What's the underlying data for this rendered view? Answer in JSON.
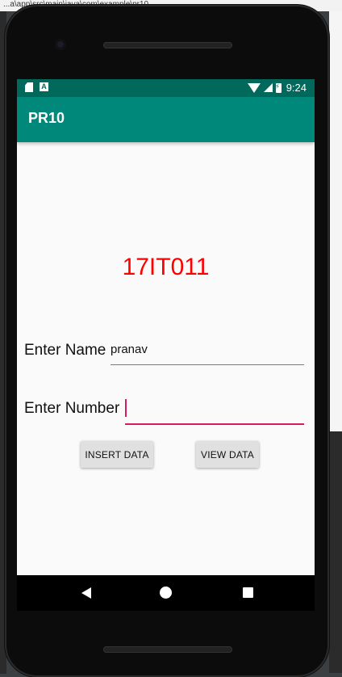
{
  "ide": {
    "top_path": "...a\\app\\src\\main\\java\\com\\example\\pr10..."
  },
  "status_bar": {
    "time": "9:24",
    "sd_icon": "sd-card-icon",
    "a_icon": "a-notification-icon"
  },
  "app_bar": {
    "title": "PR10"
  },
  "content": {
    "headline": "17IT011",
    "headline_color": "#ff0000",
    "name_label": "Enter Name",
    "name_value": "pranav",
    "number_label": "Enter Number",
    "number_value": "",
    "insert_button": "INSERT DATA",
    "view_button": "VIEW DATA"
  },
  "colors": {
    "status_bar": "#00695c",
    "app_bar": "#00897b",
    "accent": "#d81b60"
  },
  "nav_bar": {
    "back_icon": "back-icon",
    "home_icon": "home-icon",
    "recents_icon": "recents-icon"
  }
}
